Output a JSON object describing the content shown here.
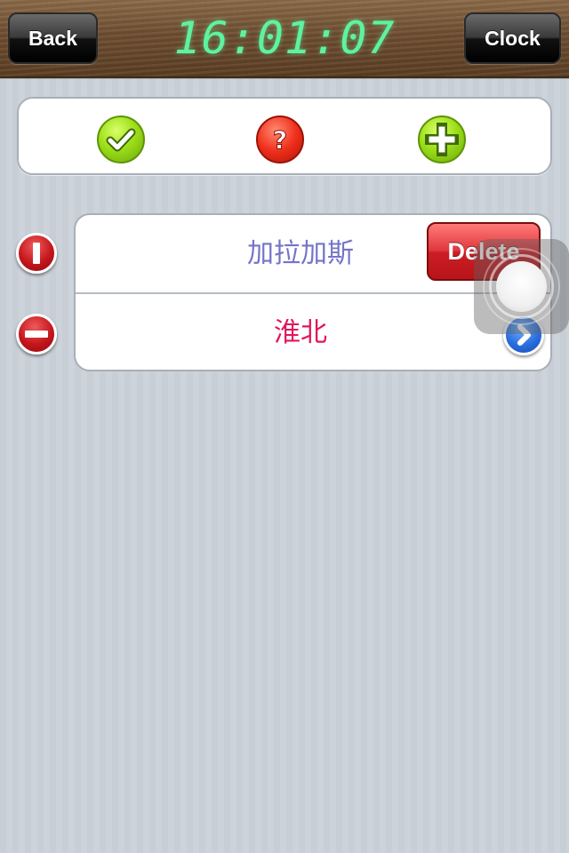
{
  "header": {
    "back_label": "Back",
    "clock_label": "Clock",
    "time": "16:01:07"
  },
  "actions": {
    "confirm_icon": "check-icon",
    "help_icon": "question-icon",
    "add_icon": "plus-icon"
  },
  "cities": [
    {
      "name": "加拉加斯",
      "color": "#7474c8"
    },
    {
      "name": "淮北",
      "color": "#e0185a"
    }
  ],
  "delete_label": "Delete",
  "colors": {
    "clock_digits": "#5ef2a0",
    "delete_red": "#d52a2e",
    "edit_red": "#c4161c",
    "disclosure_blue": "#2a6fe0",
    "confirm_green": "#9ee01a"
  }
}
